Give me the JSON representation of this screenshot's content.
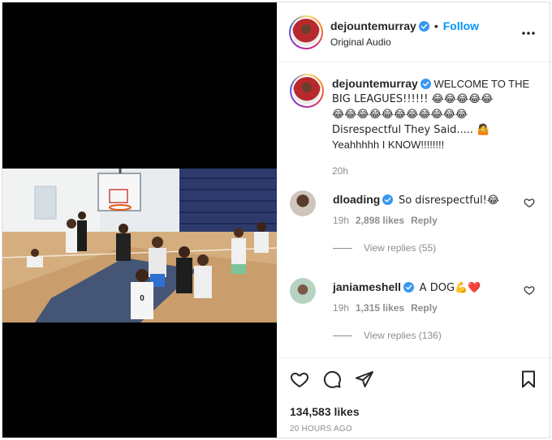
{
  "post": {
    "username": "dejountemurray",
    "follow_label": "Follow",
    "audio_label": "Original Audio",
    "caption_lines": [
      "WELCOME TO THE",
      "BIG LEAGUES!!!!!! 😂😂😂😂😂",
      "😂😂😂😂😂😂😂😂😂😂😂",
      "Disrespectful They Said..... 🤷",
      "Yeahhhhh I KNOW!!!!!!!!"
    ],
    "caption_time": "20h",
    "likes_label": "134,583 likes",
    "posted_ago": "20 HOURS AGO"
  },
  "comments": [
    {
      "username": "dloading",
      "text": "So disrespectful!😂",
      "time": "19h",
      "likes": "2,898 likes",
      "reply_label": "Reply",
      "view_replies": "View replies (55)"
    },
    {
      "username": "janiameshell",
      "text": "A DOG💪❤️",
      "time": "19h",
      "likes": "1,315 likes",
      "reply_label": "Reply",
      "view_replies": "View replies (136)"
    }
  ],
  "video": {
    "jersey_number": "0"
  },
  "icons": {
    "more": "more-options-icon",
    "verified": "verified-badge-icon",
    "heart": "heart-icon",
    "comment": "comment-icon",
    "share": "share-icon",
    "save": "bookmark-icon"
  },
  "colors": {
    "accent": "#0095f6",
    "verified": "#3897f0",
    "muted": "#8e8e8e"
  }
}
